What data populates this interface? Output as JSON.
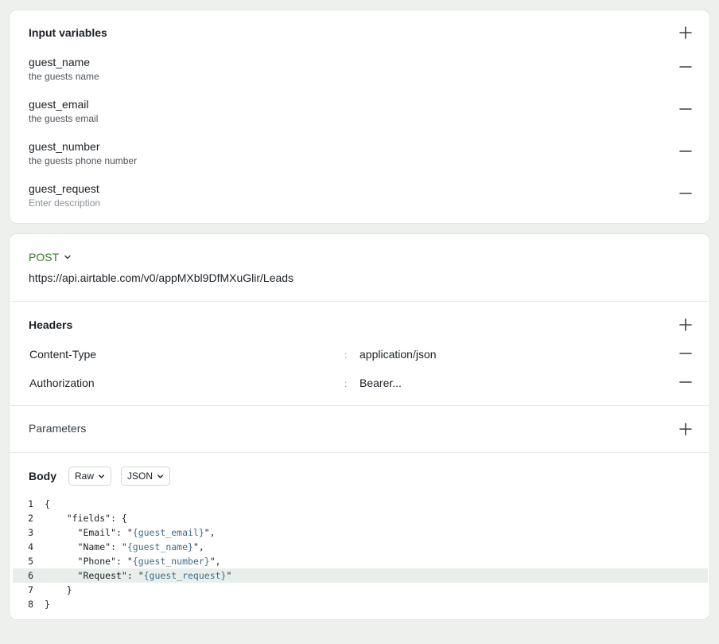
{
  "input_variables": {
    "title": "Input variables",
    "items": [
      {
        "name": "guest_name",
        "description": "the guests name",
        "placeholder": false
      },
      {
        "name": "guest_email",
        "description": "the guests email",
        "placeholder": false
      },
      {
        "name": "guest_number",
        "description": "the guests phone number",
        "placeholder": false
      },
      {
        "name": "guest_request",
        "description": "Enter description",
        "placeholder": true
      }
    ]
  },
  "request": {
    "method": "POST",
    "url": "https://api.airtable.com/v0/appMXbl9DfMXuGlir/Leads"
  },
  "headers": {
    "title": "Headers",
    "items": [
      {
        "key": "Content-Type",
        "separator": ":",
        "value": "application/json"
      },
      {
        "key": "Authorization",
        "separator": ":",
        "value": "Bearer..."
      }
    ]
  },
  "parameters": {
    "title": "Parameters"
  },
  "body": {
    "title": "Body",
    "mode": "Raw",
    "format": "JSON",
    "active_line": 6,
    "lines": [
      {
        "n": "1",
        "segments": [
          {
            "t": "{",
            "k": "str"
          }
        ]
      },
      {
        "n": "2",
        "segments": [
          {
            "t": "    \"fields\": {",
            "k": "str"
          }
        ]
      },
      {
        "n": "3",
        "segments": [
          {
            "t": "      \"Email\": \"",
            "k": "str"
          },
          {
            "t": "{guest_email}",
            "k": "var"
          },
          {
            "t": "\",",
            "k": "str"
          }
        ]
      },
      {
        "n": "4",
        "segments": [
          {
            "t": "      \"Name\": \"",
            "k": "str"
          },
          {
            "t": "{guest_name}",
            "k": "var"
          },
          {
            "t": "\",",
            "k": "str"
          }
        ]
      },
      {
        "n": "5",
        "segments": [
          {
            "t": "      \"Phone\": \"",
            "k": "str"
          },
          {
            "t": "{guest_number}",
            "k": "var"
          },
          {
            "t": "\",",
            "k": "str"
          }
        ]
      },
      {
        "n": "6",
        "segments": [
          {
            "t": "      \"Request\": \"",
            "k": "str"
          },
          {
            "t": "{guest_request}",
            "k": "var"
          },
          {
            "t": "\"",
            "k": "str"
          }
        ]
      },
      {
        "n": "7",
        "segments": [
          {
            "t": "    }",
            "k": "str"
          }
        ]
      },
      {
        "n": "8",
        "segments": [
          {
            "t": "}",
            "k": "str"
          }
        ]
      }
    ]
  },
  "colors": {
    "method": "#3a7a2a",
    "variable_token": "#3c6e8a",
    "active_line_bg": "#e8efea",
    "page_bg": "#eef0ee"
  },
  "icons": {
    "add": "plus-icon",
    "remove": "minus-icon",
    "dropdown": "chevron-down-icon"
  }
}
